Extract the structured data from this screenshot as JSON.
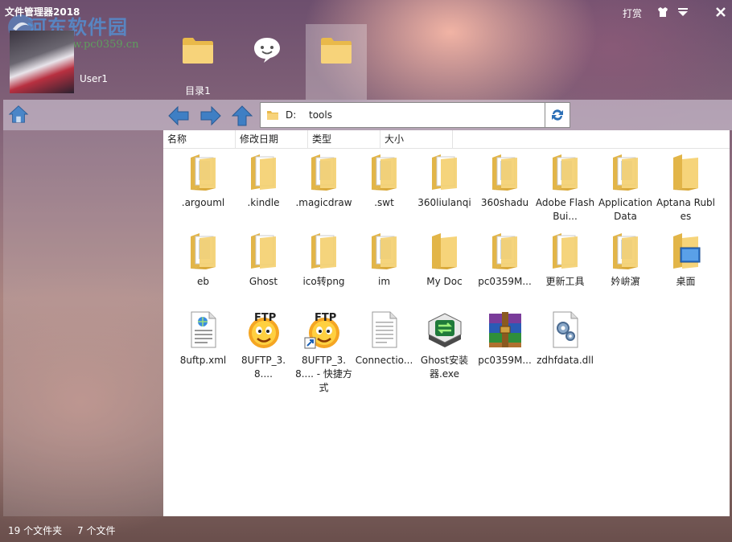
{
  "window": {
    "title": "文件管理器2018",
    "watermark": "河东软件园",
    "watermark_url": "www.pc0359.cn",
    "tip_label": "打赏"
  },
  "user": {
    "name": "User1"
  },
  "tabs": [
    {
      "label": "目录1",
      "icon": "folder-icon"
    },
    {
      "label": "",
      "icon": "chat-icon"
    },
    {
      "label": "",
      "icon": "folder-icon"
    }
  ],
  "address": {
    "drive": "D:",
    "path": "tools"
  },
  "columns": [
    "名称",
    "修改日期",
    "类型",
    "大小"
  ],
  "files": [
    {
      "name": ".argouml",
      "icon": "folder-doc"
    },
    {
      "name": ".kindle",
      "icon": "folder-blank"
    },
    {
      "name": ".magicdraw",
      "icon": "folder-doc"
    },
    {
      "name": ".swt",
      "icon": "folder-doc"
    },
    {
      "name": "360liulanqi",
      "icon": "folder-blank"
    },
    {
      "name": "360shadu",
      "icon": "folder-doc"
    },
    {
      "name": "Adobe Flash Bui...",
      "icon": "folder-doc"
    },
    {
      "name": "Application Data",
      "icon": "folder-doc"
    },
    {
      "name": "Aptana Rubles",
      "icon": "folder-plain"
    },
    {
      "name": "eb",
      "icon": "folder-doc"
    },
    {
      "name": "Ghost",
      "icon": "folder-blank"
    },
    {
      "name": "ico转png",
      "icon": "folder-blank"
    },
    {
      "name": "im",
      "icon": "folder-doc"
    },
    {
      "name": "My Doc",
      "icon": "folder-plain"
    },
    {
      "name": "pc0359M...",
      "icon": "folder-doc"
    },
    {
      "name": "更新工具",
      "icon": "folder-blank"
    },
    {
      "name": "妗峅濵",
      "icon": "folder-doc"
    },
    {
      "name": "桌面",
      "icon": "folder-desktop"
    },
    {
      "name": "8uftp.xml",
      "icon": "xml-file"
    },
    {
      "name": "8UFTP_3.8....",
      "icon": "ftp-app"
    },
    {
      "name": "8UFTP_3.8.... - 快捷方式",
      "icon": "ftp-shortcut"
    },
    {
      "name": "Connectio...",
      "icon": "text-file"
    },
    {
      "name": "Ghost安装器.exe",
      "icon": "ghost-app"
    },
    {
      "name": "pc0359M...",
      "icon": "rar-archive"
    },
    {
      "name": "zdhfdata.dll",
      "icon": "dll-file"
    }
  ],
  "status": {
    "folders": "19 个文件夹",
    "files": "7 个文件"
  }
}
